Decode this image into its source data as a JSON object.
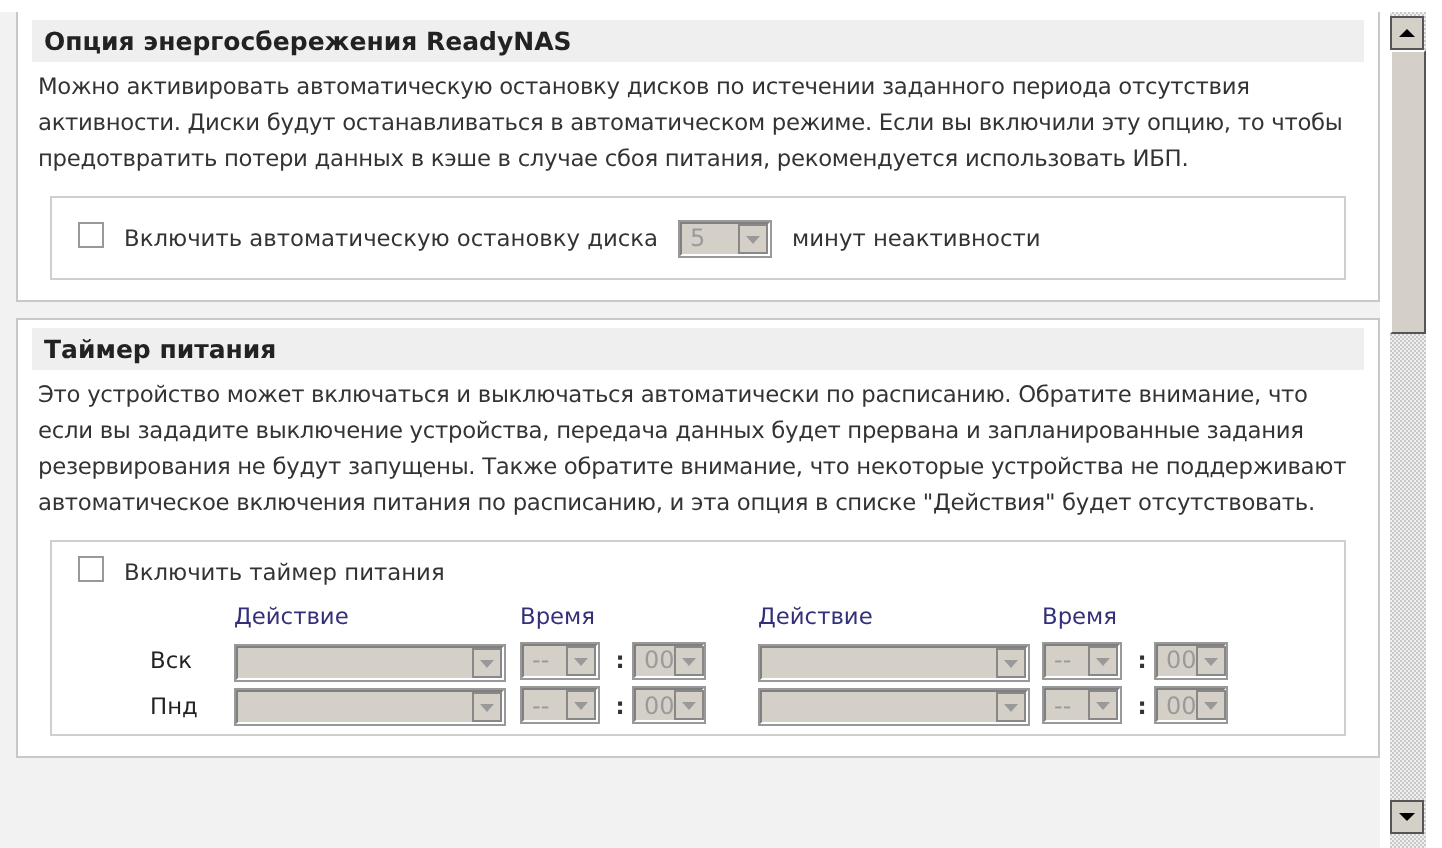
{
  "power_saving": {
    "title": "Опция энергосбережения ReadyNAS",
    "description": "Можно активировать автоматическую остановку дисков по истечении заданного периода отсутствия активности. Диски будут останавливаться в автоматическом режиме. Если вы включили эту опцию, то чтобы предотвратить потери данных в кэше в случае сбоя питания, рекомендуется использовать ИБП.",
    "checkbox": {
      "label": "Включить автоматическую остановку диска",
      "checked": false
    },
    "select": {
      "value": "5",
      "disabled": true
    },
    "suffix": "минут неактивности"
  },
  "power_timer": {
    "title": "Таймер питания",
    "description": "Это устройство может включаться и выключаться автоматически по расписанию. Обратите внимание, что если вы зададите выключение устройства, передача данных будет прервана и запланированные задания резервирования не будут запущены. Также обратите внимание, что некоторые устройства не поддерживают автоматическое включения питания по расписанию, и эта опция в списке \"Действия\" будет отсутствовать.",
    "checkbox": {
      "label": "Включить таймер питания",
      "checked": false
    },
    "column_headers": [
      "Действие",
      "Время",
      "Действие",
      "Время"
    ],
    "rows": [
      {
        "day": "Вск",
        "slots": [
          {
            "hour": "--",
            "separator": ":",
            "minute": "00",
            "disabled": true
          },
          {
            "hour": "--",
            "separator": ":",
            "minute": "00",
            "disabled": true
          }
        ]
      },
      {
        "day": "Пнд",
        "slots": [
          {
            "hour": "--",
            "separator": ":",
            "minute": "00",
            "disabled": true
          },
          {
            "hour": "--",
            "separator": ":",
            "minute": "00",
            "disabled": true
          }
        ]
      }
    ]
  }
}
